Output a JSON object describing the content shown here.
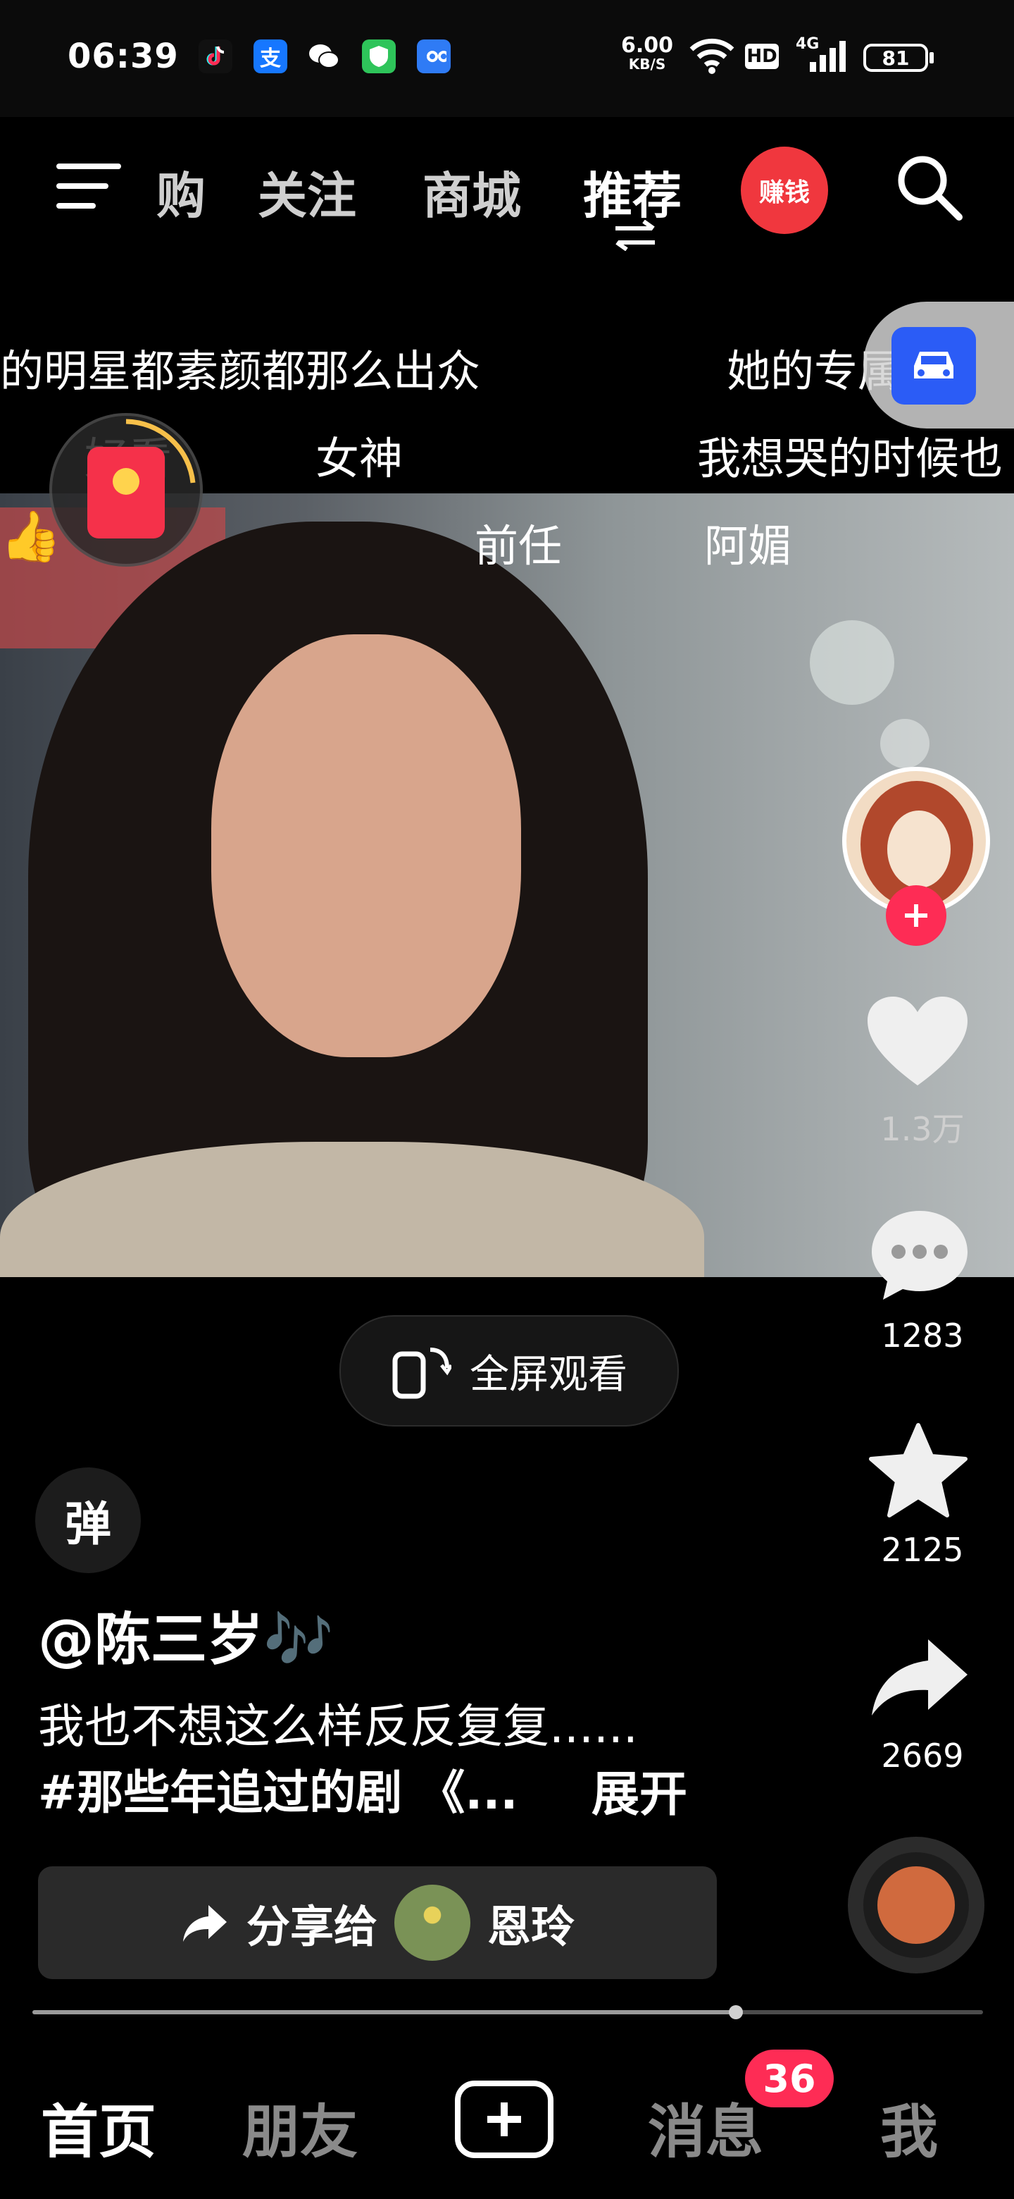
{
  "status_bar": {
    "time": "06:39",
    "net_speed_value": "6.00",
    "net_speed_unit": "KB/S",
    "hd_label": "HD",
    "network_label": "4G",
    "battery": "81"
  },
  "top_nav": {
    "tabs": [
      {
        "label": "购"
      },
      {
        "label": "关注"
      },
      {
        "label": "商城"
      },
      {
        "label": "推荐"
      }
    ],
    "earn_label": "赚钱"
  },
  "danmaku": {
    "line1": [
      "的明星都素颜都那么出众",
      "她的专属"
    ],
    "line2": [
      "好看",
      "女神",
      "我想哭的时候也"
    ],
    "line3": [
      "前任",
      "阿媚"
    ]
  },
  "rail": {
    "likes": "1.3万",
    "comments": "1283",
    "favorites": "2125",
    "shares": "2669"
  },
  "fullscreen_label": "全屏观看",
  "danmaku_toggle_label": "弹",
  "author": "@陈三岁🎶",
  "caption_line1": "我也不想这么样反反复复......",
  "caption_line2": "#那些年追过的剧 《...",
  "expand_label": "展开",
  "share": {
    "prefix": "分享给",
    "name": "恩玲"
  },
  "progress": 0.74,
  "bottom_nav": {
    "home": "首页",
    "friends": "朋友",
    "messages": "消息",
    "message_badge": "36",
    "me": "我"
  },
  "colors": {
    "accent_red": "#fe2c55",
    "car_blue": "#2b5cf6"
  }
}
